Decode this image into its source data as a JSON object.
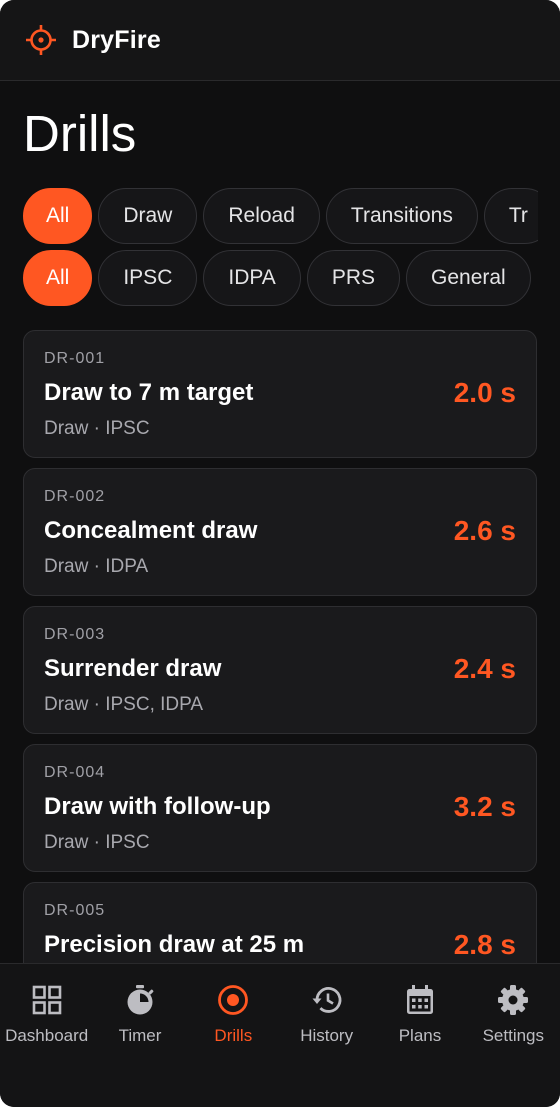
{
  "app": {
    "title": "DryFire",
    "accent": "#ff5722"
  },
  "page": {
    "title": "Drills"
  },
  "category_filters": [
    {
      "label": "All",
      "active": true
    },
    {
      "label": "Draw",
      "active": false
    },
    {
      "label": "Reload",
      "active": false
    },
    {
      "label": "Transitions",
      "active": false
    },
    {
      "label": "Tr",
      "active": false
    }
  ],
  "discipline_filters": [
    {
      "label": "All",
      "active": true
    },
    {
      "label": "IPSC",
      "active": false
    },
    {
      "label": "IDPA",
      "active": false
    },
    {
      "label": "PRS",
      "active": false
    },
    {
      "label": "General",
      "active": false
    }
  ],
  "drills": [
    {
      "id": "DR-001",
      "title": "Draw to 7 m target",
      "meta": "Draw · IPSC",
      "time": "2.0 s"
    },
    {
      "id": "DR-002",
      "title": "Concealment draw",
      "meta": "Draw · IDPA",
      "time": "2.6 s"
    },
    {
      "id": "DR-003",
      "title": "Surrender draw",
      "meta": "Draw · IPSC, IDPA",
      "time": "2.4 s"
    },
    {
      "id": "DR-004",
      "title": "Draw with follow-up",
      "meta": "Draw · IPSC",
      "time": "3.2 s"
    },
    {
      "id": "DR-005",
      "title": "Precision draw at 25 m",
      "meta": "",
      "time": "2.8 s"
    }
  ],
  "nav": [
    {
      "label": "Dashboard",
      "icon": "dashboard-icon",
      "active": false
    },
    {
      "label": "Timer",
      "icon": "stopwatch-icon",
      "active": false
    },
    {
      "label": "Drills",
      "icon": "target-icon",
      "active": true
    },
    {
      "label": "History",
      "icon": "history-icon",
      "active": false
    },
    {
      "label": "Plans",
      "icon": "calendar-icon",
      "active": false
    },
    {
      "label": "Settings",
      "icon": "gear-icon",
      "active": false
    }
  ]
}
